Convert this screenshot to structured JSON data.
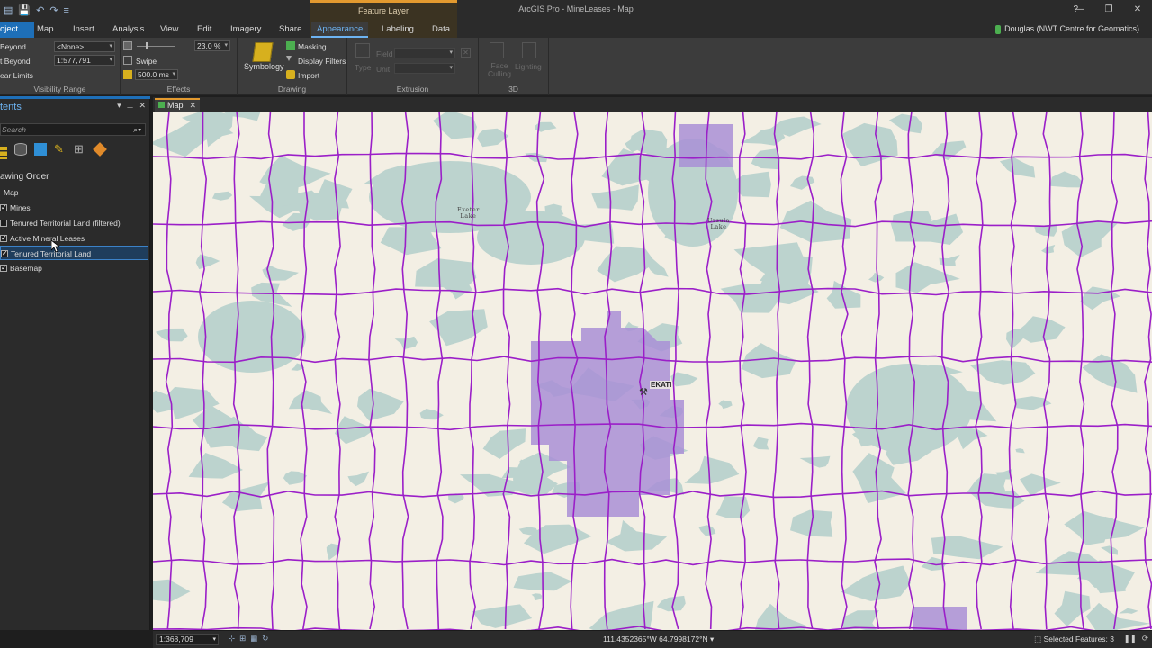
{
  "app": {
    "title": "ArcGIS Pro - MineLeases - Map",
    "context_header": "Feature Layer",
    "user": "Douglas (NWT Centre for Geomatics)",
    "help": "?",
    "window_controls": [
      "—",
      "❐",
      "✕"
    ]
  },
  "tabs": [
    "oject",
    "Map",
    "Insert",
    "Analysis",
    "View",
    "Edit",
    "Imagery",
    "Share",
    "Appearance",
    "Labeling",
    "Data"
  ],
  "ribbon": {
    "visibility": {
      "label": "Visibility Range",
      "beyond_label": "Beyond",
      "beyond_value": "<None>",
      "tbeyond_label": "t Beyond",
      "tbeyond_value": "1:577,791",
      "clear_label": "ear Limits"
    },
    "effects": {
      "label": "Effects",
      "transparency": "23.0  %",
      "swipe": "Swipe",
      "flicker": "500.0  ms"
    },
    "drawing": {
      "label": "Drawing",
      "symbology": "Symbology",
      "masking": "Masking",
      "display_filters": "Display Filters",
      "import": "Import"
    },
    "extrusion": {
      "label": "Extrusion",
      "type": "Type",
      "field": "Field",
      "unit": "Unit"
    },
    "three_d": {
      "label": "3D",
      "face_culling_1": "Face",
      "face_culling_2": "Culling",
      "lighting": "Lighting"
    }
  },
  "contents": {
    "title": "tents",
    "search_placeholder": "Search",
    "drawing_order": "awing Order",
    "map_name": "Map",
    "layers": [
      {
        "name": "Mines",
        "checked": true
      },
      {
        "name": "Tenured Territorial Land (filtered)",
        "checked": false
      },
      {
        "name": "Active Mineral Leases",
        "checked": true
      },
      {
        "name": "Tenured Territorial Land",
        "checked": true,
        "selected": true
      },
      {
        "name": "Basemap",
        "checked": true
      }
    ]
  },
  "map": {
    "tab_label": "Map",
    "labels": {
      "exeter": "Exeter\nLake",
      "ursula": "Ursula\nLake",
      "mine": "EKATI"
    },
    "colors": {
      "land": "#f3efe4",
      "water": "#bcd3ce",
      "grid": "#9b1fc8",
      "lease": "#a98fd6"
    }
  },
  "status": {
    "scale": "1:368,709",
    "coordinates": "111.4352365°W 64.7998172°N",
    "selected_features": "Selected Features: 3"
  }
}
